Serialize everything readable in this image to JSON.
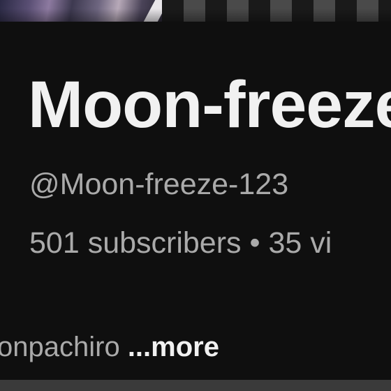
{
  "channel": {
    "name": "Moon-freeze",
    "handle": "@Moon-freeze-123",
    "stats": "501 subscribers • 35 vi",
    "description_snippet": "onpachiro",
    "more_label": "...more"
  },
  "colors": {
    "background": "#0f0f0f",
    "primary_text": "#f1f1f1",
    "secondary_text": "#aaaaaa"
  }
}
